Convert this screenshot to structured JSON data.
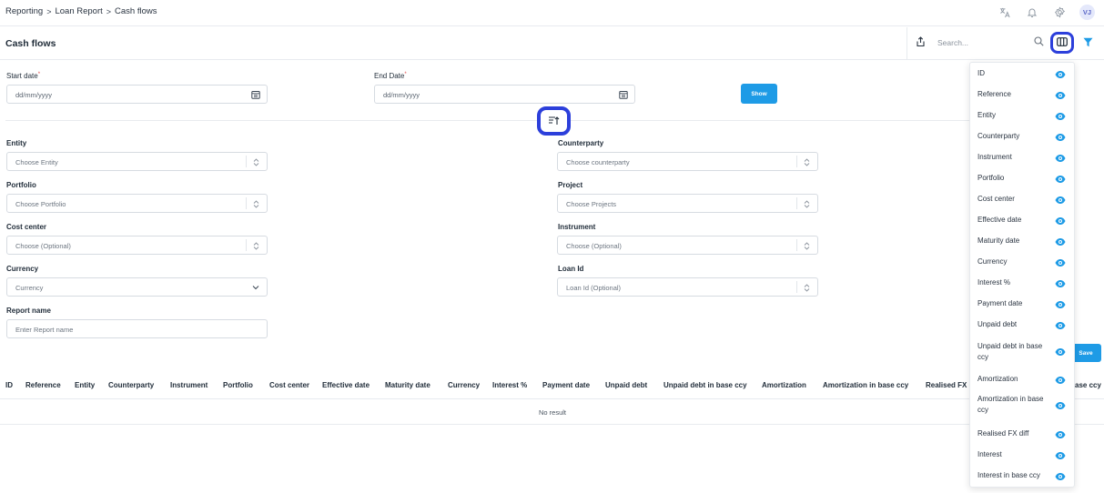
{
  "breadcrumb": [
    "Reporting",
    "Loan Report",
    "Cash flows"
  ],
  "breadcrumb_sep": ">",
  "user_initials": "VJ",
  "page_title": "Cash flows",
  "search": {
    "placeholder": "Search..."
  },
  "dates": {
    "start_label": "Start date",
    "end_label": "End Date",
    "required_mark": "*",
    "start_placeholder": "dd/mm/yyyy",
    "end_placeholder": "dd/mm/yyyy",
    "show_label": "Show"
  },
  "filters": {
    "entity": {
      "label": "Entity",
      "placeholder": "Choose Entity"
    },
    "counterparty": {
      "label": "Counterparty",
      "placeholder": "Choose counterparty"
    },
    "portfolio": {
      "label": "Portfolio",
      "placeholder": "Choose Portfolio"
    },
    "project": {
      "label": "Project",
      "placeholder": "Choose Projects"
    },
    "cost_center": {
      "label": "Cost center",
      "placeholder": "Choose (Optional)"
    },
    "instrument": {
      "label": "Instrument",
      "placeholder": "Choose (Optional)"
    },
    "currency": {
      "label": "Currency",
      "placeholder": "Currency"
    },
    "loan_id": {
      "label": "Loan Id",
      "placeholder": "Loan Id (Optional)"
    },
    "report_name": {
      "label": "Report name",
      "placeholder": "Enter Report name"
    }
  },
  "save_label": "Save",
  "table": {
    "columns": [
      "ID",
      "Reference",
      "Entity",
      "Counterparty",
      "Instrument",
      "Portfolio",
      "Cost center",
      "Effective date",
      "Maturity date",
      "Currency",
      "Interest %",
      "Payment date",
      "Unpaid debt",
      "Unpaid debt in base ccy",
      "Amortization",
      "Amortization in base ccy",
      "Realised FX d",
      "ase ccy"
    ],
    "empty_text": "No result"
  },
  "column_panel": {
    "items": [
      "ID",
      "Reference",
      "Entity",
      "Counterparty",
      "Instrument",
      "Portfolio",
      "Cost center",
      "Effective date",
      "Maturity date",
      "Currency",
      "Interest %",
      "Payment date",
      "Unpaid debt",
      "Unpaid debt in base ccy",
      "Amortization",
      "Amortization in base ccy",
      "Realised FX diff",
      "Interest",
      "Interest in base ccy"
    ],
    "visible": [
      true,
      true,
      true,
      true,
      true,
      true,
      true,
      true,
      true,
      true,
      true,
      true,
      true,
      true,
      true,
      true,
      true,
      true,
      true
    ]
  },
  "colors": {
    "accent": "#1e9be6",
    "highlight": "#2c3fdb"
  },
  "icons": [
    "translate-icon",
    "bell-icon",
    "gear-icon",
    "export-icon",
    "search-icon",
    "columns-icon",
    "filter-icon",
    "calendar-icon",
    "sort-updown-icon",
    "chevron-down-icon",
    "collapse-icon",
    "eye-icon"
  ]
}
